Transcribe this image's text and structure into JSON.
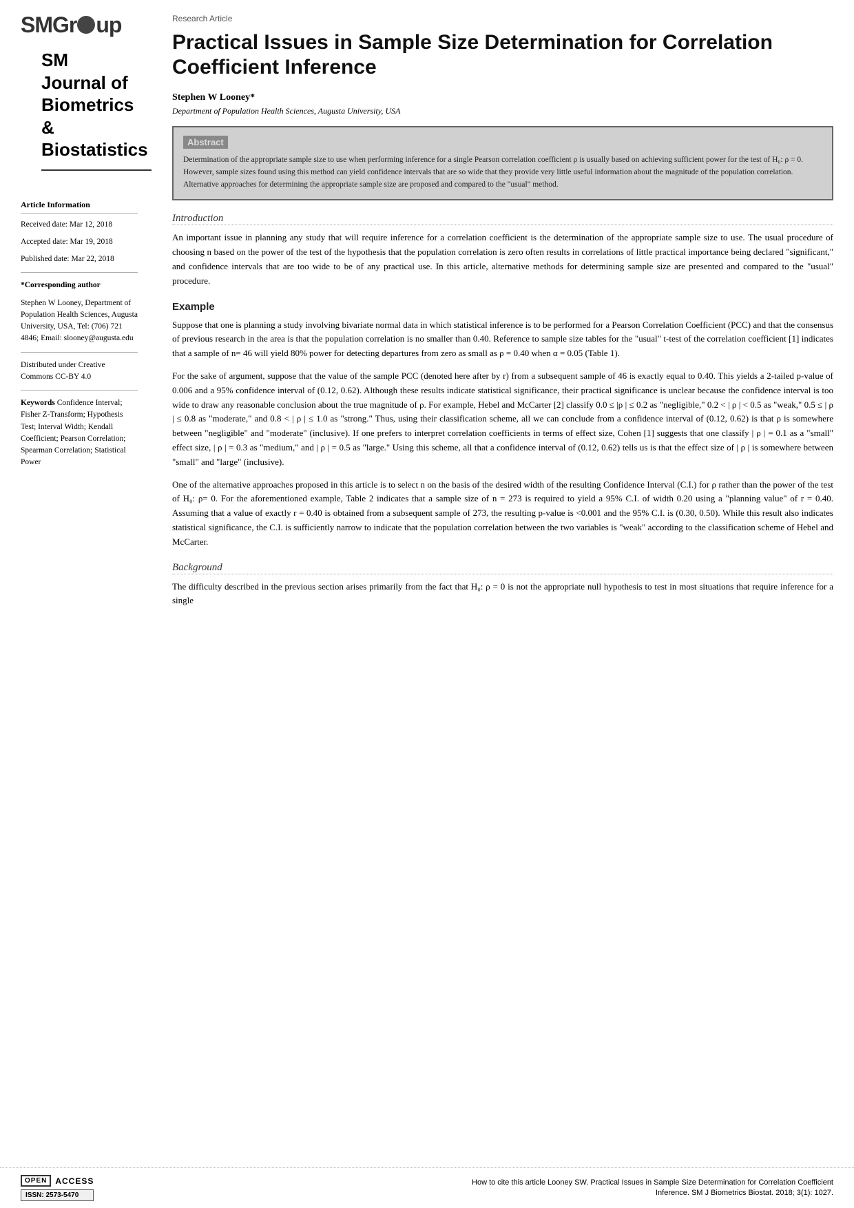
{
  "logo": {
    "text_before": "SMGr",
    "text_after": "up",
    "icon_symbol": "●"
  },
  "journal_title": {
    "line1": "SM Journal of",
    "line2": "Biometrics &",
    "line3": "Biostatistics"
  },
  "article_info": {
    "section_label": "Article Information",
    "received": "Received date: Mar 12, 2018",
    "accepted": "Accepted date: Mar 19, 2018",
    "published": "Published date: Mar 22, 2018",
    "corresponding_label": "*Corresponding author",
    "corresponding_text": "Stephen W Looney, Department of Population Health Sciences, Augusta University, USA, Tel: (706) 721 4846; Email: slooney@augusta.edu",
    "distributed": "Distributed under Creative Commons CC-BY 4.0",
    "keywords_label": "Keywords",
    "keywords": "Confidence Interval; Fisher Z-Transform; Hypothesis Test; Interval Width; Kendall Coefficient; Pearson Correlation; Spearman Correlation; Statistical Power"
  },
  "header": {
    "article_type": "Research Article"
  },
  "title": "Practical Issues in Sample Size Determination for Correlation Coefficient Inference",
  "author": {
    "name": "Stephen W Looney*",
    "affiliation": "Department of Population Health Sciences, Augusta University, USA"
  },
  "abstract": {
    "label": "Abstract",
    "text": "Determination of the appropriate sample size to use when performing inference for a single Pearson correlation coefficient ρ is usually based on achieving sufficient power for the test of H₀: ρ = 0. However, sample sizes found using this method can yield confidence intervals that are so wide that they provide very little useful information about the magnitude of the population correlation. Alternative approaches for determining the appropriate sample size are proposed and compared to the \"usual\" method."
  },
  "sections": {
    "introduction": {
      "heading": "Introduction",
      "paragraph1": "An important issue in planning any study that will require inference for a correlation coefficient is the determination of the appropriate sample size to use. The usual procedure of choosing n based on the power of the test of the hypothesis that the population correlation is zero often results in correlations of little practical importance being declared \"significant,\" and confidence intervals that are too wide to be of any practical use. In this article, alternative methods for determining sample size are presented and compared to the \"usual\" procedure."
    },
    "example": {
      "heading": "Example",
      "paragraph1": "Suppose that one is planning a study involving bivariate normal data in which statistical inference is to be performed for a Pearson Correlation Coefficient (PCC) and that the consensus of previous research in the area is that the population correlation is no smaller than 0.40. Reference to sample size tables for the \"usual\" t-test of the correlation coefficient [1] indicates that a sample of n= 46 will yield 80% power for detecting departures from zero as small as ρ = 0.40 when α = 0.05 (Table 1).",
      "paragraph2": "For the sake of argument, suppose that the value of the sample PCC (denoted here after by r) from a subsequent sample of 46 is exactly equal to 0.40. This yields a 2-tailed p-value of 0.006 and a 95% confidence interval of (0.12, 0.62). Although these results indicate statistical significance, their practical significance is unclear because the confidence interval is too wide to draw any reasonable conclusion about the true magnitude of ρ. For example, Hebel and McCarter [2] classify 0.0 ≤ |ρ | ≤ 0.2 as \"negligible,\" 0.2 < | ρ | < 0.5 as \"weak,\" 0.5 ≤ | ρ | ≤ 0.8 as \"moderate,\" and 0.8 < | ρ | ≤ 1.0 as \"strong.\" Thus, using their classification scheme, all we can conclude from a confidence interval of (0.12, 0.62) is that ρ is somewhere between \"negligible\" and \"moderate\" (inclusive). If one prefers to interpret correlation coefficients in terms of effect size, Cohen [1] suggests that one classify | ρ | = 0.1 as a \"small\" effect size, | ρ | = 0.3 as \"medium,\" and | ρ | = 0.5 as \"large.\" Using this scheme, all that a confidence interval of (0.12, 0.62) tells us is that the effect size of | ρ | is somewhere between \"small\" and \"large\" (inclusive).",
      "paragraph3": "One of the alternative approaches proposed in this article is to select n on the basis of the desired width of the resulting Confidence Interval (C.I.) for ρ rather than the power of the test of H₀: ρ= 0. For the aforementioned example, Table 2 indicates that a sample size of n = 273 is required to yield a 95% C.I. of width 0.20 using a \"planning value\" of r = 0.40. Assuming that a value of exactly r = 0.40 is obtained from a subsequent sample of 273, the resulting p-value is <0.001 and the 95% C.I. is (0.30, 0.50). While this result also indicates statistical significance, the C.I. is sufficiently narrow to indicate that the population correlation between the two variables is \"weak\" according to the classification scheme of Hebel and McCarter."
    },
    "background": {
      "heading": "Background",
      "paragraph1": "The difficulty described in the previous section arises primarily from the fact that H₀: ρ = 0 is not the appropriate null hypothesis to test in most situations that require inference for a single"
    }
  },
  "footer": {
    "open_access_label": "OPEN",
    "access_label": "ACCESS",
    "issn": "ISSN: 2573-5470",
    "cite_text": "How to cite this article Looney SW. Practical Issues in Sample Size Determination for Correlation Coefficient Inference. SM J Biometrics Biostat. 2018; 3(1): 1027."
  }
}
